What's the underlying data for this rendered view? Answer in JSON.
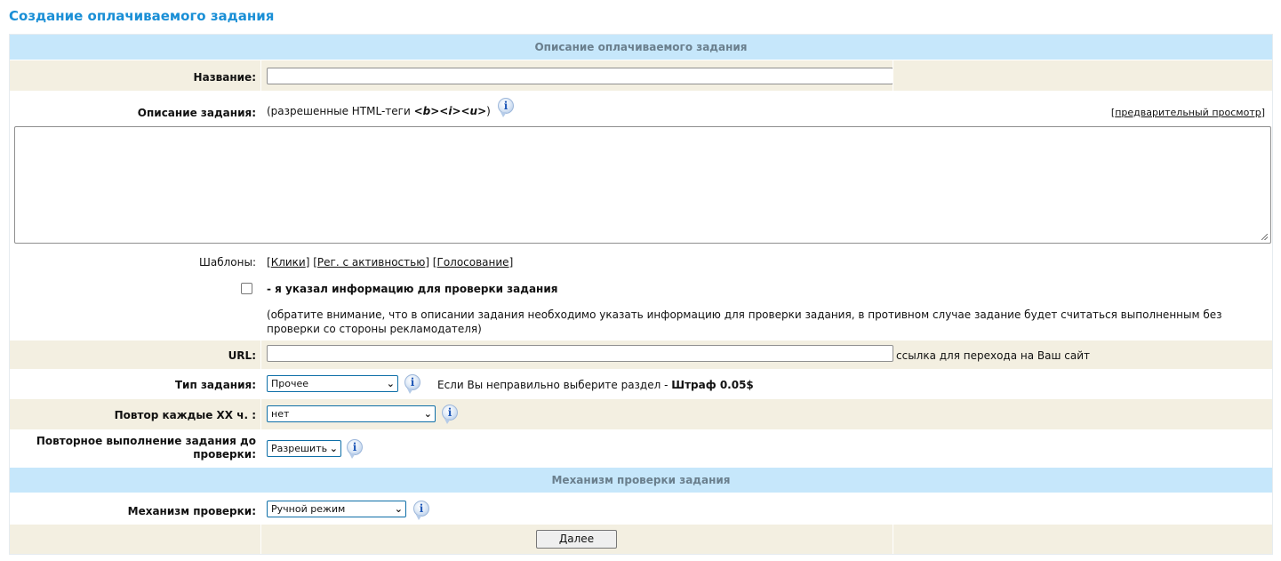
{
  "page_title": "Создание оплачиваемого задания",
  "section1": {
    "title": "Описание оплачиваемого задания"
  },
  "name": {
    "label": "Название:",
    "value": ""
  },
  "description": {
    "label": "Описание задания:",
    "allowed_prefix": "(разрешенные HTML-теги",
    "allowed_tags": "<b><i><u>",
    "allowed_suffix": ")",
    "preview_link": "предварительный просмотр",
    "value": ""
  },
  "templates": {
    "label": "Шаблоны:",
    "items": [
      "Клики",
      "Рег. с активностью",
      "Голосование"
    ]
  },
  "verify": {
    "checkbox_label": "- я указал информацию для проверки задания",
    "checked": false,
    "note": "(обратите внимание, что в описании задания необходимо указать информацию для проверки задания, в противном случае задание будет считаться выполненным без проверки со стороны рекламодателя)"
  },
  "url": {
    "label": "URL:",
    "value": "",
    "hint": "ссылка для перехода на Ваш сайт"
  },
  "task_type": {
    "label": "Тип задания:",
    "value": "Прочее",
    "warning_text": "Если Вы неправильно выберите раздел -",
    "penalty": "Штраф 0.05$"
  },
  "repeat": {
    "label": "Повтор каждые XX ч. :",
    "value": "нет"
  },
  "re_execution": {
    "label_line1": "Повторное выполнение задания до",
    "label_line2": "проверки:",
    "value": "Разрешить"
  },
  "section2": {
    "title": "Механизм проверки задания"
  },
  "mechanism": {
    "label": "Механизм проверки:",
    "value": "Ручной режим"
  },
  "next_button": "Далее",
  "icons": {
    "info": "info-icon",
    "dropdown": "chevron-down-icon",
    "resize": "resize-grip-icon"
  },
  "colors": {
    "title": "#1a8fd6",
    "section_header_bg": "#c6e7fb",
    "row_beige": "#f3efe1",
    "select_border": "#0e6fa8"
  }
}
